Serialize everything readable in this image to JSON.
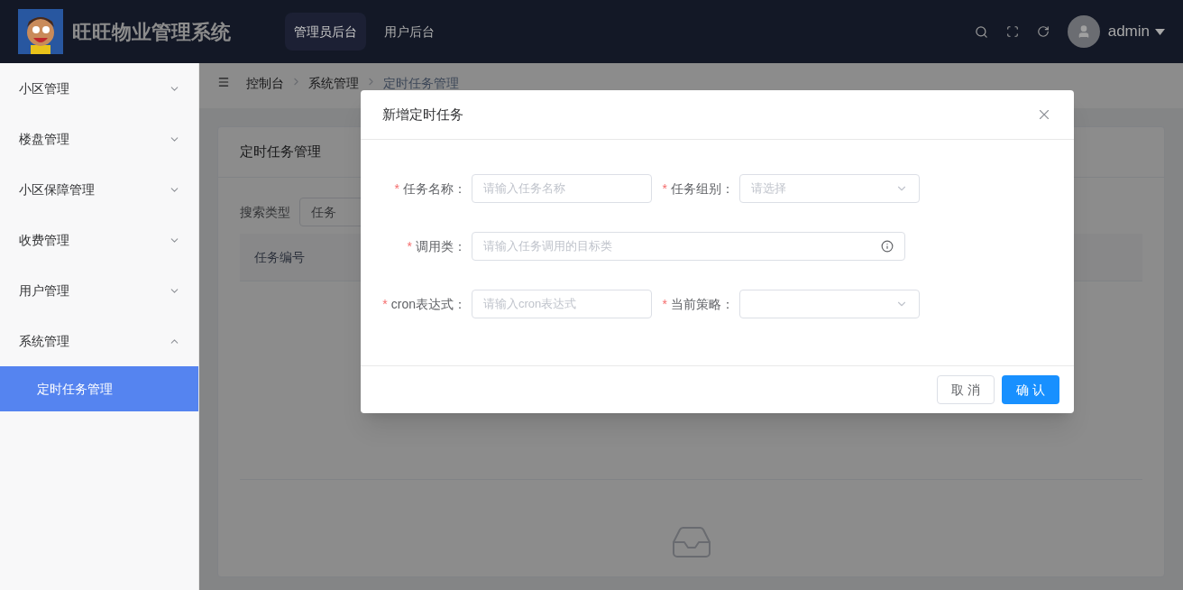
{
  "header": {
    "title": "旺旺物业管理系统",
    "nav": [
      {
        "label": "管理员后台",
        "selected": true
      },
      {
        "label": "用户后台",
        "selected": false
      }
    ],
    "user": "admin"
  },
  "sidebar": {
    "items": [
      {
        "label": "小区管理",
        "expanded": false
      },
      {
        "label": "楼盘管理",
        "expanded": false
      },
      {
        "label": "小区保障管理",
        "expanded": false
      },
      {
        "label": "收费管理",
        "expanded": false
      },
      {
        "label": "用户管理",
        "expanded": false
      },
      {
        "label": "系统管理",
        "expanded": true,
        "children": [
          {
            "label": "定时任务管理",
            "selected": true
          }
        ]
      }
    ]
  },
  "breadcrumb": [
    "控制台",
    "系统管理",
    "定时任务管理"
  ],
  "card": {
    "title": "定时任务管理",
    "search_label": "搜索类型",
    "search_type": "任务",
    "table": {
      "columns": [
        "任务编号"
      ]
    }
  },
  "dialog": {
    "title": "新增定时任务",
    "rows": [
      [
        {
          "required_mark": "*",
          "label": "任务名称：",
          "kind": "input",
          "placeholder": "请输入任务名称"
        },
        {
          "required_mark": "*",
          "label": "任务组别：",
          "kind": "select",
          "placeholder": "请选择"
        }
      ],
      [
        {
          "required_mark": "*",
          "label": "调用类：",
          "kind": "wide",
          "placeholder": "请输入任务调用的目标类"
        }
      ],
      [
        {
          "required_mark": "*",
          "label": "cron表达式：",
          "kind": "input",
          "placeholder": "请输入cron表达式"
        },
        {
          "required_mark": "*",
          "label": "当前策略：",
          "kind": "select"
        }
      ]
    ],
    "buttons": [
      {
        "label": "取 消",
        "kind": "default"
      },
      {
        "label": "确 认",
        "kind": "primary"
      }
    ]
  }
}
